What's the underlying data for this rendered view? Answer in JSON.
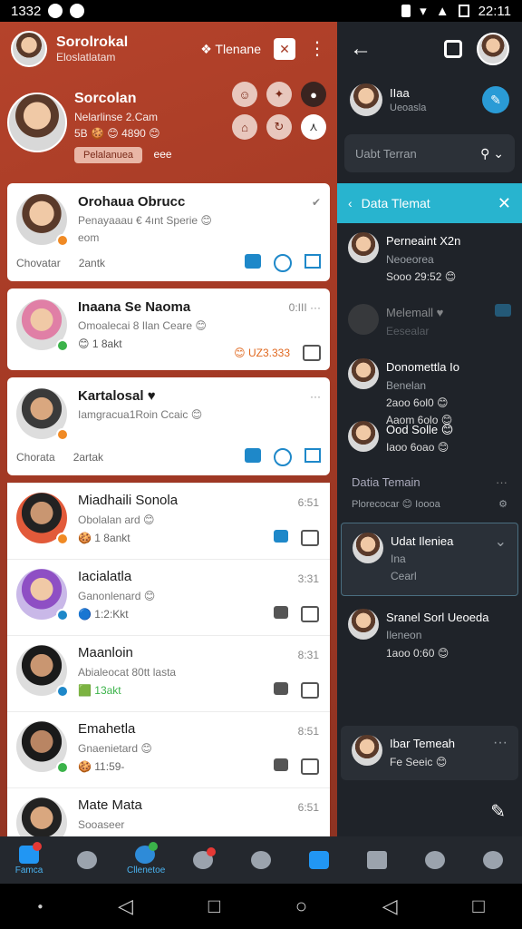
{
  "status": {
    "time_left": "1332",
    "time_right": "22:11"
  },
  "left_header": {
    "title": "Sorolrokal",
    "subtitle": "Eloslatlatam",
    "action": "Tlenane"
  },
  "profile": {
    "name": "Sorcolan",
    "line1": "Nelarlinse 2.Cam",
    "line2": "5B 🍪 😊 4890 😊",
    "pill": "Pelalanuea",
    "more": "eee"
  },
  "cards": [
    {
      "name": "Orohaua Obrucc",
      "sub": "Penayaaau € 4ınt Sperie 😊",
      "sub2": "eom",
      "foot_left": "Chovatar",
      "foot_mid": "2antk",
      "time": ""
    },
    {
      "name": "Inaana Se Naoma",
      "sub": "Omoalecai 8 Ilan Ceare 😊",
      "sub2": "😊 1 8akt",
      "foot_right": "😊 UZ3.333",
      "time": "0:III"
    },
    {
      "name": "Kartalosal ♥",
      "sub": "Iamgracua1Roin Ccaic 😊",
      "foot_left": "Chorata",
      "foot_mid": "2artak",
      "time": ""
    }
  ],
  "rows": [
    {
      "name": "Miadhaili Sonola",
      "sub": "Obolalan ard 😊",
      "sub2": "🍪 1 8ankt",
      "time": "6:51"
    },
    {
      "name": "Iacialatla",
      "sub": "Ganonlenard 😊",
      "sub2": "🔵 1:2:Kkt",
      "time": "3:31"
    },
    {
      "name": "Maanloin",
      "sub": "Abialeocat 80tt lasta",
      "sub2": "🟩 13akt",
      "time": "8:31"
    },
    {
      "name": "Emahetla",
      "sub": "Gnaenietard 😊",
      "sub2": "🍪 11:59-",
      "time": "8:51"
    },
    {
      "name": "Mate Mata",
      "sub": "Sooaseer",
      "time": "6:51"
    }
  ],
  "right": {
    "user": {
      "name": "IIaa",
      "sub": "Ueoasla"
    },
    "search_placeholder": "Uabt Terran",
    "panel_title": "Data Tlemat",
    "items": [
      {
        "name": "Perneaint X2n",
        "sub": "Neoeorea",
        "sub2": "Sooo 29:52 😊"
      },
      {
        "name": "Melemall ♥",
        "sub": "Eesealar",
        "sub2": ""
      },
      {
        "name": "Donomettla Io",
        "sub": "Benelan",
        "sub2": "2aoo 6ol0 😊",
        "sub3": "Aaom 6olo 😊"
      },
      {
        "name": "Ood Solle 😊",
        "sub": "Iaoo 6oao 😊",
        "sub2": ""
      }
    ],
    "section": {
      "title": "Datia Temain",
      "sub": "Plorecocar 😊 Ioooa",
      "dots": "···"
    },
    "boxed": {
      "name": "Udat Ileniea",
      "sub": "Ina",
      "sub2": "Cearl"
    },
    "item_last": {
      "name": "Sranel Sorl Ueoeda",
      "sub": "Ileneon",
      "sub2": "1aoo 0:60 😊"
    },
    "bottom": {
      "name": "Ibar Temeah",
      "sub": "Fe Seeic 😊",
      "dots": "···"
    }
  },
  "nav": {
    "first_label": "Famca",
    "hl_label": "Cllenetoe"
  }
}
